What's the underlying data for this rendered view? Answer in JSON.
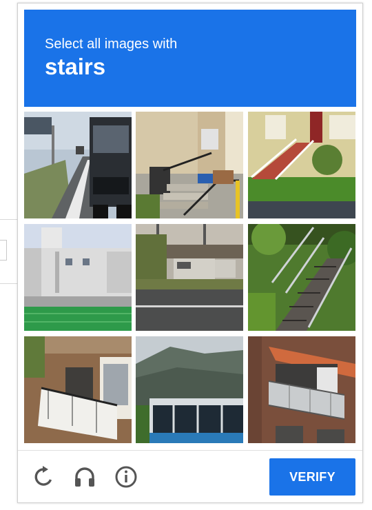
{
  "challenge": {
    "instruction": "Select all images with",
    "target_word": "stairs",
    "grid_rows": 3,
    "grid_cols": 3,
    "tiles": [
      {
        "index": 1,
        "depicts": "highway with truck"
      },
      {
        "index": 2,
        "depicts": "house entrance with steps and railing"
      },
      {
        "index": 3,
        "depicts": "yellow house with red porch stairs"
      },
      {
        "index": 4,
        "depicts": "white building behind green fence"
      },
      {
        "index": 5,
        "depicts": "road with parked van"
      },
      {
        "index": 6,
        "depicts": "outdoor stairway on grassy hill"
      },
      {
        "index": 7,
        "depicts": "brick building with balcony"
      },
      {
        "index": 8,
        "depicts": "bus and mountains"
      },
      {
        "index": 9,
        "depicts": "brick building with balconies and awning"
      }
    ]
  },
  "footer": {
    "reload_icon": "reload-icon",
    "audio_icon": "headphones-icon",
    "info_icon": "info-icon",
    "verify_label": "VERIFY"
  },
  "colors": {
    "accent": "#1a73e8",
    "icon_gray": "#555555"
  }
}
